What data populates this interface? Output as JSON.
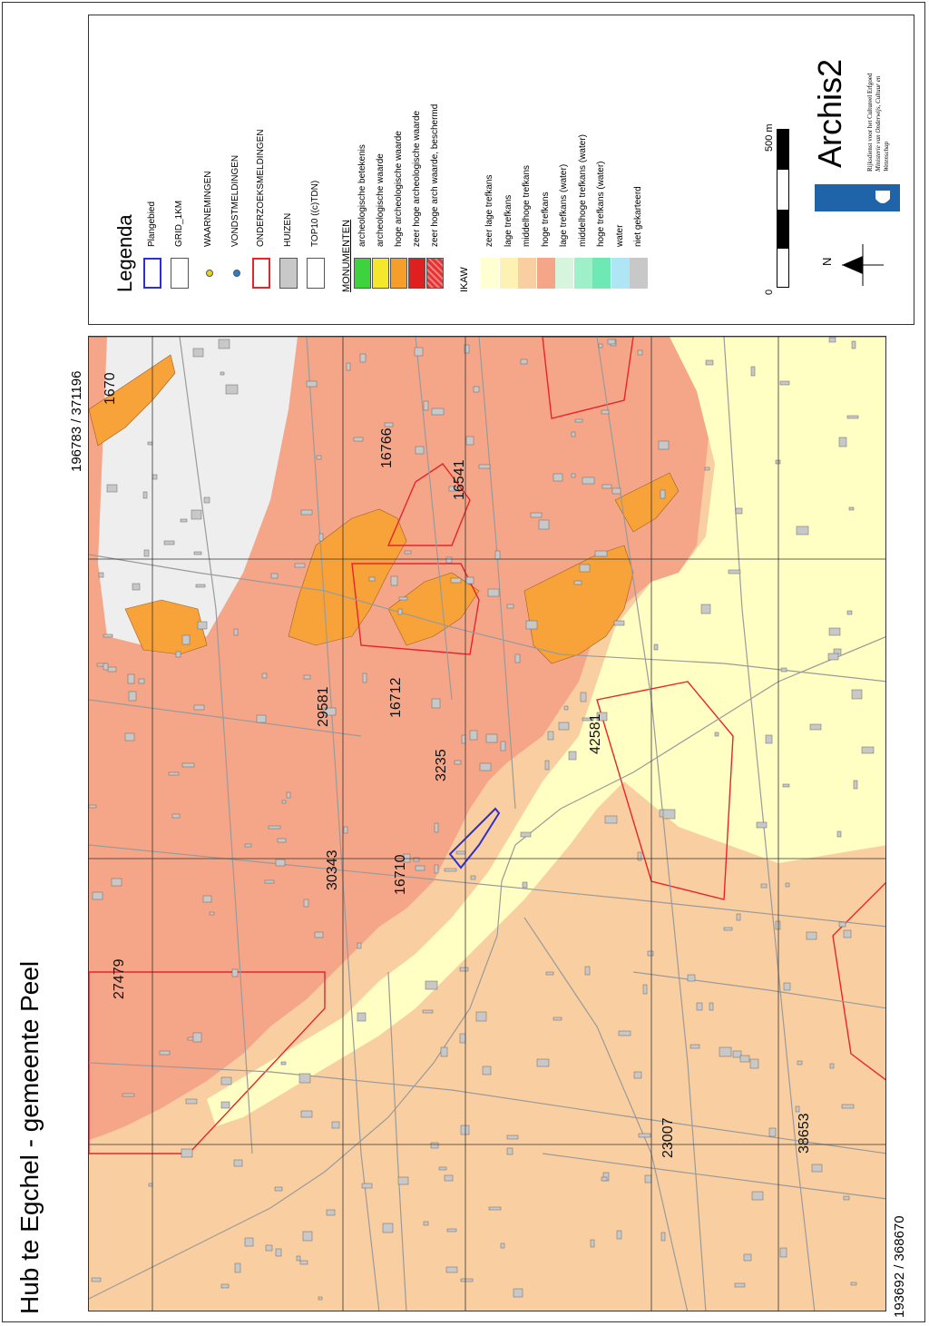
{
  "title": "Hub te Egchel - gemeente Peel",
  "coords": {
    "top_right": "196783 / 371196",
    "bottom_left": "193692 / 368670"
  },
  "map": {
    "labels": [
      "1670",
      "16766",
      "16541",
      "16712",
      "29581",
      "3235",
      "30343",
      "16710",
      "42581",
      "27479",
      "23007",
      "38653"
    ],
    "colors": {
      "zeer_lage": "#ffffc4",
      "middelhoge": "#f9cfa2",
      "hoge": "#f5a689",
      "huizen": "#c8c8c8",
      "monument": "#f7a33a",
      "onderzoek": "#e8242b",
      "plangebied": "#2f2fd0"
    }
  },
  "legend": {
    "heading": "Legenda",
    "items": [
      {
        "label": "Plangebied",
        "icon": "plangebied-swatch"
      },
      {
        "label": "GRID_1KM",
        "icon": "grid-swatch"
      },
      {
        "label": "WAARNEMINGEN",
        "icon": "yellow-dot-icon"
      },
      {
        "label": "VONDSTMELDINGEN",
        "icon": "blue-dot-icon"
      },
      {
        "label": "ONDERZOEKSMELDINGEN",
        "icon": "red-outline-swatch"
      },
      {
        "label": "HUIZEN",
        "icon": "grey-swatch"
      },
      {
        "label": "TOP10 ((c)TDN)",
        "icon": "white-swatch"
      }
    ],
    "monumenten": {
      "heading": "MONUMENTEN",
      "items": [
        {
          "label": "archeologische betekenis",
          "color": "#3fd23f"
        },
        {
          "label": "archeologische waarde",
          "color": "#f5e82a"
        },
        {
          "label": "hoge archeologische waarde",
          "color": "#f59e2a"
        },
        {
          "label": "zeer hoge archeologische waarde",
          "color": "#e02020"
        },
        {
          "label": "zeer hoge arch waarde, beschermd",
          "color": "#e63434"
        }
      ]
    },
    "ikaw": {
      "heading": "IKAW",
      "items": [
        {
          "label": "zeer lage trefkans",
          "color": "#ffffd2"
        },
        {
          "label": "lage trefkans",
          "color": "#fdf2b3"
        },
        {
          "label": "middelhoge trefkans",
          "color": "#f9cfa2"
        },
        {
          "label": "hoge trefkans",
          "color": "#f5a689"
        },
        {
          "label": "lage trefkans (water)",
          "color": "#d7f5dc"
        },
        {
          "label": "middelhoge trefkans (water)",
          "color": "#9ef0c8"
        },
        {
          "label": "hoge trefkans (water)",
          "color": "#6ee9b4"
        },
        {
          "label": "water",
          "color": "#aee6f5"
        },
        {
          "label": "niet gekarteerd",
          "color": "#c8c8c8"
        }
      ]
    },
    "scale": {
      "zero": "0",
      "max": "500 m"
    },
    "north": "N",
    "brand": {
      "name": "Archis2",
      "org_line1": "Rijksdienst voor het Cultureel Erfgoed",
      "org_line2": "Ministerie van Onderwijs, Cultuur en",
      "org_line3": "Wetenschap"
    }
  }
}
